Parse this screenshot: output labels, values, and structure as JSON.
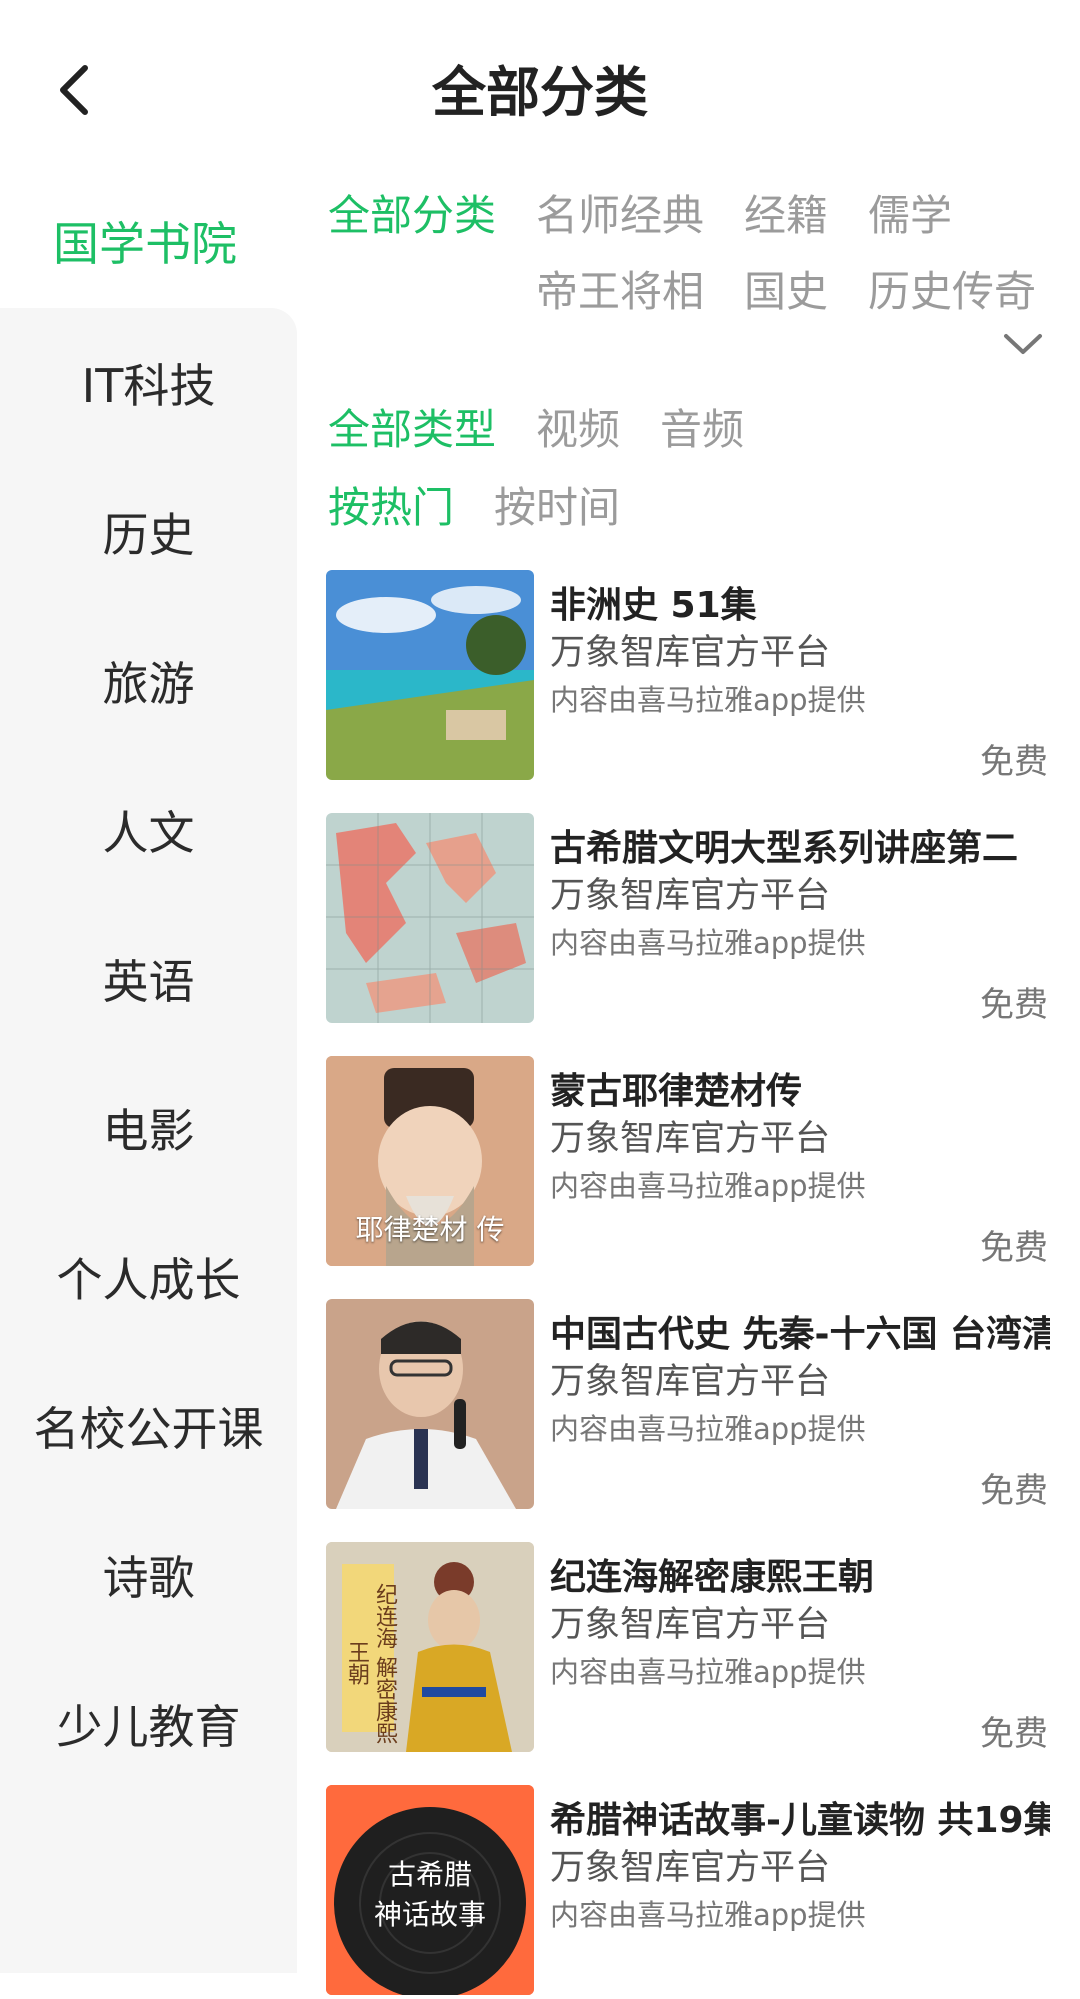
{
  "header": {
    "title": "全部分类"
  },
  "sidebar": {
    "active": "国学书院",
    "items": [
      "IT科技",
      "历史",
      "旅游",
      "人文",
      "英语",
      "电影",
      "个人成长",
      "名校公开课",
      "诗歌",
      "少儿教育"
    ]
  },
  "filters": {
    "categories": [
      "全部分类",
      "名师经典",
      "经籍",
      "儒学",
      "帝王将相",
      "国史",
      "历史传奇"
    ],
    "types": [
      "全部类型",
      "视频",
      "音频"
    ],
    "sort": [
      "按热门",
      "按时间"
    ]
  },
  "colors": {
    "accent": "#1dbf65",
    "inactive_chip": "#9b9b9b",
    "sidebar_bg": "#f6f6f6"
  },
  "items": [
    {
      "title": "非洲史 51集",
      "source": "万象智库官方平台",
      "provider": "内容由喜马拉雅app提供",
      "price": "免费"
    },
    {
      "title": "古希腊文明大型系列讲座第二",
      "source": "万象智库官方平台",
      "provider": "内容由喜马拉雅app提供",
      "price": "免费"
    },
    {
      "title": "蒙古耶律楚材传",
      "source": "万象智库官方平台",
      "provider": "内容由喜马拉雅app提供",
      "price": "免费",
      "thumb_text": "耶律楚材 传"
    },
    {
      "title": "中国古代史 先秦-十六国 台湾清",
      "source": "万象智库官方平台",
      "provider": "内容由喜马拉雅app提供",
      "price": "免费"
    },
    {
      "title": "纪连海解密康熙王朝",
      "source": "万象智库官方平台",
      "provider": "内容由喜马拉雅app提供",
      "price": "免费",
      "thumb_text": "纪连海 解密康熙王朝"
    },
    {
      "title": "希腊神话故事-儿童读物 共19集",
      "source": "万象智库官方平台",
      "provider": "内容由喜马拉雅app提供",
      "thumb_text_1": "古希腊",
      "thumb_text_2": "神话故事"
    }
  ]
}
